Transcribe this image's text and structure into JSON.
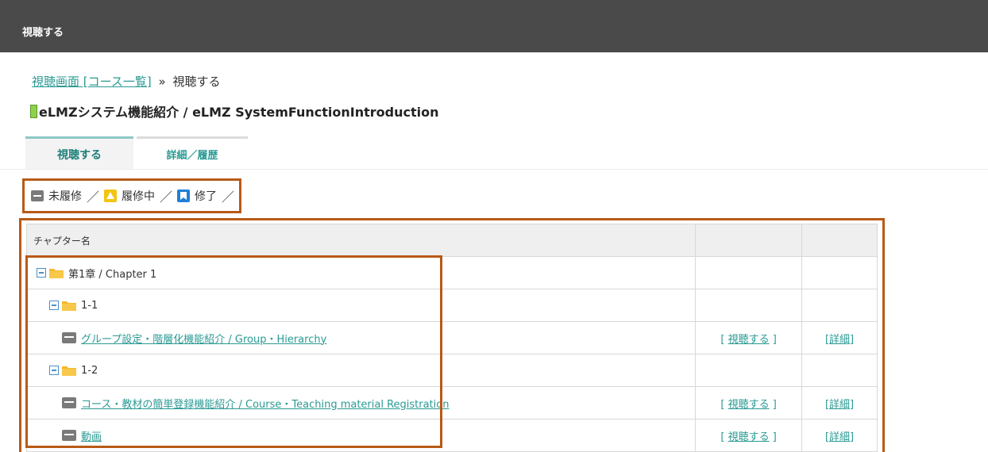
{
  "header": {
    "title": "視聴する"
  },
  "breadcrumb": {
    "link": "視聴画面 [コース一覧]",
    "separator": "»",
    "current": "視聴する"
  },
  "course": {
    "title": "eLMZシステム機能紹介 / eLMZ SystemFunctionIntroduction"
  },
  "tabs": [
    {
      "label": "視聴する",
      "active": true
    },
    {
      "label": "詳細／履歴",
      "active": false
    }
  ],
  "legend": {
    "not_started": "未履修",
    "in_progress": "履修中",
    "completed": "修了",
    "slash": "／"
  },
  "table": {
    "headers": {
      "name": "チャプター名",
      "view": "",
      "detail": ""
    },
    "rows": [
      {
        "type": "chapter",
        "label": "第1章 / Chapter 1"
      },
      {
        "type": "section",
        "label": "1-1"
      },
      {
        "type": "item",
        "label": "グループ設定・階層化機能紹介 / Group・Hierarchy",
        "view": "視聴する",
        "detail": "詳細"
      },
      {
        "type": "section",
        "label": "1-2"
      },
      {
        "type": "item",
        "label": "コース・教材の簡単登録機能紹介 / Course・Teaching material Registration",
        "view": "視聴する",
        "detail": "詳細"
      },
      {
        "type": "item",
        "label": "動画",
        "view": "視聴する",
        "detail": "詳細"
      }
    ]
  },
  "colors": {
    "header_bg": "#4a4a4a",
    "accent_teal": "#2a9a93",
    "highlight_orange": "#b85a16",
    "status_gray": "#7a7a7a",
    "status_yellow": "#f2c511",
    "status_blue": "#1f7fd6",
    "folder_yellow": "#f5b82e"
  }
}
